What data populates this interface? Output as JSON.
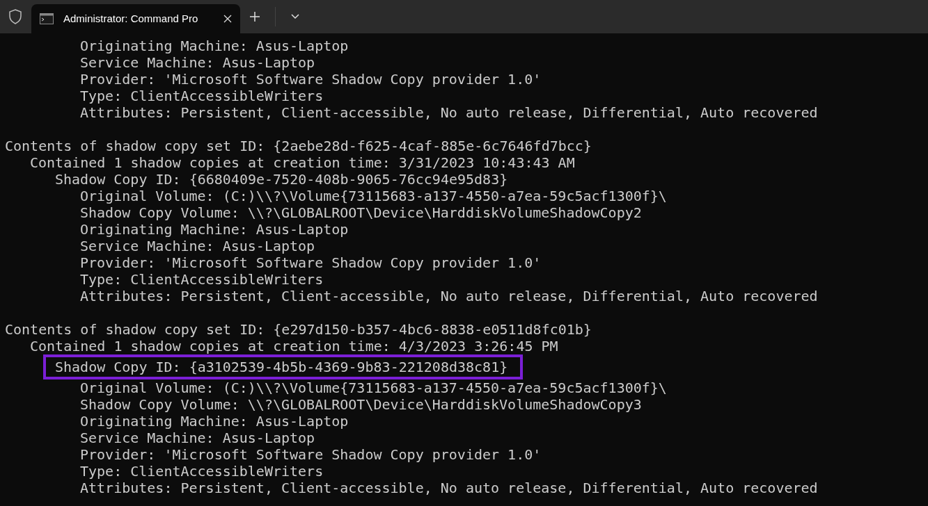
{
  "tab": {
    "title": "Administrator: Command Pro",
    "selected": true
  },
  "lines": [
    {
      "kind": "property",
      "text": "Originating Machine: Asus-Laptop",
      "highlighted": false
    },
    {
      "kind": "property",
      "text": "Service Machine: Asus-Laptop",
      "highlighted": false
    },
    {
      "kind": "property",
      "text": "Provider: 'Microsoft Software Shadow Copy provider 1.0'",
      "highlighted": false
    },
    {
      "kind": "property",
      "text": "Type: ClientAccessibleWriters",
      "highlighted": false
    },
    {
      "kind": "property",
      "text": "Attributes: Persistent, Client-accessible, No auto release, Differential, Auto recovered",
      "highlighted": false
    },
    {
      "kind": "blank"
    },
    {
      "kind": "header",
      "text": "Contents of shadow copy set ID: {2aebe28d-f625-4caf-885e-6c7646fd7bcc}",
      "highlighted": false
    },
    {
      "kind": "summary",
      "text": "Contained 1 shadow copies at creation time: 3/31/2023 10:43:43 AM",
      "highlighted": false
    },
    {
      "kind": "copy_id",
      "text": "Shadow Copy ID: {6680409e-7520-408b-9065-76cc94e95d83}",
      "highlighted": false
    },
    {
      "kind": "property",
      "text": "Original Volume: (C:)\\\\?\\Volume{73115683-a137-4550-a7ea-59c5acf1300f}\\",
      "highlighted": false
    },
    {
      "kind": "property",
      "text": "Shadow Copy Volume: \\\\?\\GLOBALROOT\\Device\\HarddiskVolumeShadowCopy2",
      "highlighted": false
    },
    {
      "kind": "property",
      "text": "Originating Machine: Asus-Laptop",
      "highlighted": false
    },
    {
      "kind": "property",
      "text": "Service Machine: Asus-Laptop",
      "highlighted": false
    },
    {
      "kind": "property",
      "text": "Provider: 'Microsoft Software Shadow Copy provider 1.0'",
      "highlighted": false
    },
    {
      "kind": "property",
      "text": "Type: ClientAccessibleWriters",
      "highlighted": false
    },
    {
      "kind": "property",
      "text": "Attributes: Persistent, Client-accessible, No auto release, Differential, Auto recovered",
      "highlighted": false
    },
    {
      "kind": "blank"
    },
    {
      "kind": "header",
      "text": "Contents of shadow copy set ID: {e297d150-b357-4bc6-8838-e0511d8fc01b}",
      "highlighted": false
    },
    {
      "kind": "summary",
      "text": "Contained 1 shadow copies at creation time: 4/3/2023 3:26:45 PM",
      "highlighted": false
    },
    {
      "kind": "copy_id",
      "text": "Shadow Copy ID: {a3102539-4b5b-4369-9b83-221208d38c81}",
      "highlighted": true
    },
    {
      "kind": "property",
      "text": "Original Volume: (C:)\\\\?\\Volume{73115683-a137-4550-a7ea-59c5acf1300f}\\",
      "highlighted": false
    },
    {
      "kind": "property",
      "text": "Shadow Copy Volume: \\\\?\\GLOBALROOT\\Device\\HarddiskVolumeShadowCopy3",
      "highlighted": false
    },
    {
      "kind": "property",
      "text": "Originating Machine: Asus-Laptop",
      "highlighted": false
    },
    {
      "kind": "property",
      "text": "Service Machine: Asus-Laptop",
      "highlighted": false
    },
    {
      "kind": "property",
      "text": "Provider: 'Microsoft Software Shadow Copy provider 1.0'",
      "highlighted": false
    },
    {
      "kind": "property",
      "text": "Type: ClientAccessibleWriters",
      "highlighted": false
    },
    {
      "kind": "property",
      "text": "Attributes: Persistent, Client-accessible, No auto release, Differential, Auto recovered",
      "highlighted": false
    }
  ]
}
